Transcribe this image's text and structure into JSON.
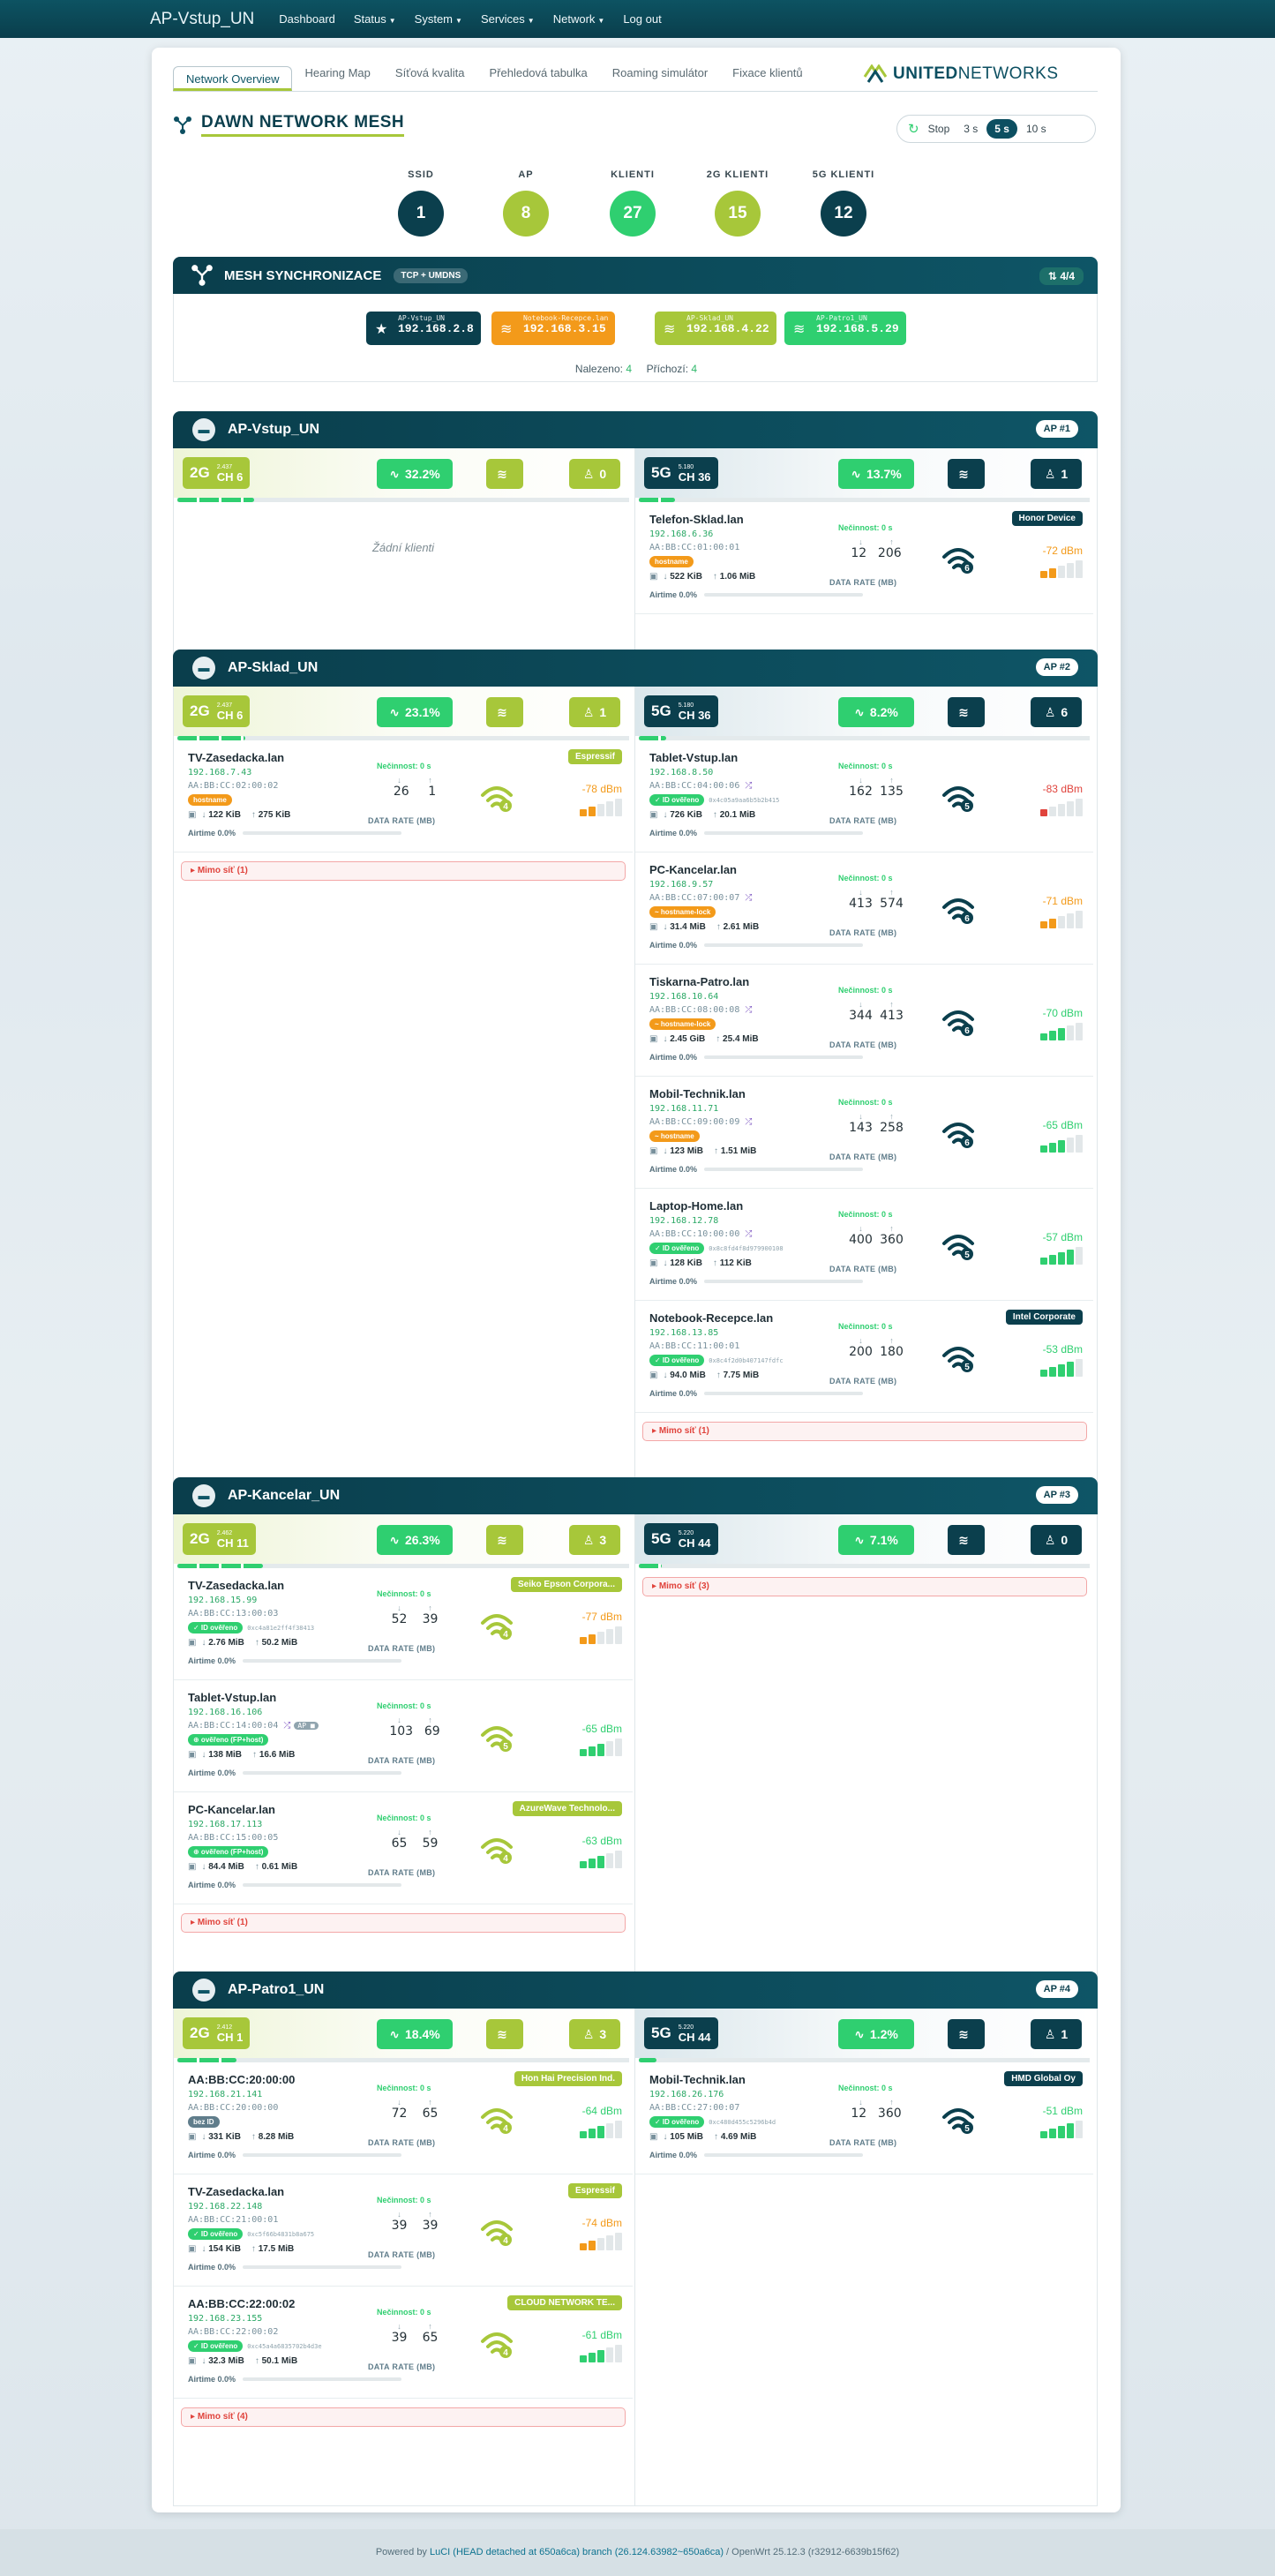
{
  "nav": {
    "brand": "AP-Vstup_UN",
    "items": [
      {
        "label": "Dashboard",
        "caret": false
      },
      {
        "label": "Status",
        "caret": true
      },
      {
        "label": "System",
        "caret": true
      },
      {
        "label": "Services",
        "caret": true
      },
      {
        "label": "Network",
        "caret": true
      },
      {
        "label": "Log out",
        "caret": false
      }
    ]
  },
  "tabs": [
    "Network Overview",
    "Hearing Map",
    "Síťová kvalita",
    "Přehledová tabulka",
    "Roaming simulátor",
    "Fixace klientů"
  ],
  "logo": {
    "a": "UNITED",
    "b": "NETWORKS"
  },
  "title": "DAWN NETWORK MESH",
  "refresh": {
    "stop": "Stop",
    "opts": [
      "3 s",
      "5 s",
      "10 s"
    ],
    "active": "5 s"
  },
  "stats": [
    {
      "label": "SSID",
      "value": "1",
      "color": "#0b3f4d"
    },
    {
      "label": "AP",
      "value": "8",
      "color": "#a7c73a"
    },
    {
      "label": "KLIENTI",
      "value": "27",
      "color": "#2fcf70"
    },
    {
      "label": "2G KLIENTI",
      "value": "15",
      "color": "#a7c73a"
    },
    {
      "label": "5G KLIENTI",
      "value": "12",
      "color": "#0b3f4d"
    }
  ],
  "sync": {
    "title": "MESH SYNCHRONIZACE",
    "tag": "TCP + UMDNS",
    "count": "4/4",
    "found_label": "Nalezeno:",
    "found": "4",
    "arrived_label": "Příchozí:",
    "arrived": "4",
    "chips": [
      {
        "name": "AP-Vstup_UN",
        "ip": "192.168.2.8",
        "color": "#0b3f4d",
        "icon": "★"
      },
      {
        "name": "Notebook-Recepce.lan",
        "ip": "192.168.3.15",
        "color": "#f39a1a",
        "icon": "≋"
      },
      {
        "name": "AP-Sklad_UN",
        "ip": "192.168.4.22",
        "color": "#a7c73a",
        "icon": "≋"
      },
      {
        "name": "AP-Patro1_UN",
        "ip": "192.168.5.29",
        "color": "#2fcf70",
        "icon": "≋"
      }
    ]
  },
  "labels": {
    "idle": "Nečinnost: 0 s",
    "data_rate": "DATA RATE (MB)",
    "airtime": "Airtime 0.0%",
    "no_clients": "Žádní klienti"
  },
  "aps": [
    {
      "name": "AP-Vstup_UN",
      "num": "AP #1",
      "g2": {
        "band": "2G",
        "freq": "2.437",
        "ch": "CH 6",
        "util": "32.2%",
        "clients": "0",
        "prog": 0.17,
        "clients_list": [],
        "mimo": ""
      },
      "g5": {
        "band": "5G",
        "freq": "5.180",
        "ch": "CH 36",
        "util": "13.7%",
        "clients": "1",
        "prog": 0.08,
        "mimo": "",
        "clients_list": [
          {
            "host": "Telefon-Sklad.lan",
            "ip": "192.168.6.36",
            "mac": "AA:BB:CC:01:00:01",
            "pill": "hostname",
            "pillc": "#f39a1a",
            "hash": "",
            "rx": "522 KiB",
            "tx": "1.06 MiB",
            "down": "12",
            "up": "206",
            "wgen": "6",
            "wc": "#0b3f4d",
            "dbm": "-72 dBm",
            "dbmc": "#f39a1a",
            "bars": 2,
            "barc": "#f39a1a",
            "vendor": "Honor Device",
            "vc": "#0b3f4d",
            "shuffle": false
          }
        ]
      }
    },
    {
      "name": "AP-Sklad_UN",
      "num": "AP #2",
      "g2": {
        "band": "2G",
        "freq": "2.437",
        "ch": "CH 6",
        "util": "23.1%",
        "clients": "1",
        "prog": 0.15,
        "mimo": "Mimo síť (1)",
        "clients_list": [
          {
            "host": "TV-Zasedacka.lan",
            "ip": "192.168.7.43",
            "mac": "AA:BB:CC:02:00:02",
            "pill": "hostname",
            "pillc": "#f39a1a",
            "hash": "",
            "rx": "122 KiB",
            "tx": "275 KiB",
            "down": "26",
            "up": "1",
            "wgen": "4",
            "wc": "#a7c73a",
            "dbm": "-78 dBm",
            "dbmc": "#f39a1a",
            "bars": 2,
            "barc": "#f39a1a",
            "vendor": "Espressif",
            "vc": "#a7c73a",
            "shuffle": false
          }
        ]
      },
      "g5": {
        "band": "5G",
        "freq": "5.180",
        "ch": "CH 36",
        "util": "8.2%",
        "clients": "6",
        "prog": 0.06,
        "mimo": "Mimo síť (1)",
        "clients_list": [
          {
            "host": "Tablet-Vstup.lan",
            "ip": "192.168.8.50",
            "mac": "AA:BB:CC:04:00:06",
            "pill": "✓ ID ověřeno",
            "pillc": "#2fcf70",
            "hash": "0x4c05a9aa6b5b2b415",
            "rx": "726 KiB",
            "tx": "20.1 MiB",
            "down": "162",
            "up": "135",
            "wgen": "5",
            "wc": "#0b3f4d",
            "dbm": "-83 dBm",
            "dbmc": "#e0433c",
            "bars": 1,
            "barc": "#e0433c",
            "vendor": "",
            "vc": "",
            "shuffle": true
          },
          {
            "host": "PC-Kancelar.lan",
            "ip": "192.168.9.57",
            "mac": "AA:BB:CC:07:00:07",
            "pill": "~ hostname-lock",
            "pillc": "#f39a1a",
            "hash": "",
            "rx": "31.4 MiB",
            "tx": "2.61 MiB",
            "down": "413",
            "up": "574",
            "wgen": "6",
            "wc": "#0b3f4d",
            "dbm": "-71 dBm",
            "dbmc": "#f39a1a",
            "bars": 2,
            "barc": "#f39a1a",
            "vendor": "",
            "vc": "",
            "shuffle": true
          },
          {
            "host": "Tiskarna-Patro.lan",
            "ip": "192.168.10.64",
            "mac": "AA:BB:CC:08:00:08",
            "pill": "~ hostname-lock",
            "pillc": "#f39a1a",
            "hash": "",
            "rx": "2.45 GiB",
            "tx": "25.4 MiB",
            "down": "344",
            "up": "413",
            "wgen": "6",
            "wc": "#0b3f4d",
            "dbm": "-70 dBm",
            "dbmc": "#2fcf70",
            "bars": 3,
            "barc": "#2fcf70",
            "vendor": "",
            "vc": "",
            "shuffle": true
          },
          {
            "host": "Mobil-Technik.lan",
            "ip": "192.168.11.71",
            "mac": "AA:BB:CC:09:00:09",
            "pill": "~ hostname",
            "pillc": "#f39a1a",
            "hash": "",
            "rx": "123 MiB",
            "tx": "1.51 MiB",
            "down": "143",
            "up": "258",
            "wgen": "6",
            "wc": "#0b3f4d",
            "dbm": "-65 dBm",
            "dbmc": "#2fcf70",
            "bars": 3,
            "barc": "#2fcf70",
            "vendor": "",
            "vc": "",
            "shuffle": true
          },
          {
            "host": "Laptop-Home.lan",
            "ip": "192.168.12.78",
            "mac": "AA:BB:CC:10:00:00",
            "pill": "✓ ID ověřeno",
            "pillc": "#2fcf70",
            "hash": "0x8c8fd4f8d979900108",
            "rx": "128 KiB",
            "tx": "112 KiB",
            "down": "400",
            "up": "360",
            "wgen": "5",
            "wc": "#0b3f4d",
            "dbm": "-57 dBm",
            "dbmc": "#2fcf70",
            "bars": 4,
            "barc": "#2fcf70",
            "vendor": "",
            "vc": "",
            "shuffle": true
          },
          {
            "host": "Notebook-Recepce.lan",
            "ip": "192.168.13.85",
            "mac": "AA:BB:CC:11:00:01",
            "pill": "✓ ID ověřeno",
            "pillc": "#2fcf70",
            "hash": "0x8c4f2d0b407147fdfc",
            "rx": "94.0 MiB",
            "tx": "7.75 MiB",
            "down": "200",
            "up": "180",
            "wgen": "5",
            "wc": "#0b3f4d",
            "dbm": "-53 dBm",
            "dbmc": "#2fcf70",
            "bars": 4,
            "barc": "#2fcf70",
            "vendor": "Intel Corporate",
            "vc": "#0b3f4d",
            "shuffle": false
          }
        ]
      }
    },
    {
      "name": "AP-Kancelar_UN",
      "num": "AP #3",
      "g2": {
        "band": "2G",
        "freq": "2.462",
        "ch": "CH 11",
        "util": "26.3%",
        "clients": "3",
        "prog": 0.19,
        "mimo": "Mimo síť (1)",
        "clients_list": [
          {
            "host": "TV-Zasedacka.lan",
            "ip": "192.168.15.99",
            "mac": "AA:BB:CC:13:00:03",
            "pill": "✓ ID ověřeno",
            "pillc": "#2fcf70",
            "hash": "0xc4a81e2ff4f38413",
            "rx": "2.76 MiB",
            "tx": "50.2 MiB",
            "down": "52",
            "up": "39",
            "wgen": "4",
            "wc": "#a7c73a",
            "dbm": "-77 dBm",
            "dbmc": "#f39a1a",
            "bars": 2,
            "barc": "#f39a1a",
            "vendor": "Seiko Epson Corpora...",
            "vc": "#a7c73a",
            "shuffle": false
          },
          {
            "host": "Tablet-Vstup.lan",
            "ip": "192.168.16.106",
            "mac": "AA:BB:CC:14:00:04",
            "pill": "⊕ ověřeno (FP+host)",
            "pillc": "#2fcf70",
            "hash": "",
            "rx": "138 MiB",
            "tx": "16.6 MiB",
            "down": "103",
            "up": "69",
            "wgen": "5",
            "wc": "#a7c73a",
            "dbm": "-65 dBm",
            "dbmc": "#2fcf70",
            "bars": 3,
            "barc": "#2fcf70",
            "vendor": "",
            "vc": "",
            "shuffle": true,
            "ap_tag": "AP"
          },
          {
            "host": "PC-Kancelar.lan",
            "ip": "192.168.17.113",
            "mac": "AA:BB:CC:15:00:05",
            "pill": "⊕ ověřeno (FP+host)",
            "pillc": "#2fcf70",
            "hash": "",
            "rx": "84.4 MiB",
            "tx": "0.61 MiB",
            "down": "65",
            "up": "59",
            "wgen": "4",
            "wc": "#a7c73a",
            "dbm": "-63 dBm",
            "dbmc": "#2fcf70",
            "bars": 3,
            "barc": "#2fcf70",
            "vendor": "AzureWave Technolo...",
            "vc": "#a7c73a",
            "shuffle": false
          }
        ]
      },
      "g5": {
        "band": "5G",
        "freq": "5.220",
        "ch": "CH 44",
        "util": "7.1%",
        "clients": "0",
        "prog": 0.05,
        "mimo": "Mimo síť (3)",
        "clients_list": []
      }
    },
    {
      "name": "AP-Patro1_UN",
      "num": "AP #4",
      "g2": {
        "band": "2G",
        "freq": "2.412",
        "ch": "CH 1",
        "util": "18.4%",
        "clients": "3",
        "prog": 0.13,
        "mimo": "Mimo síť (4)",
        "clients_list": [
          {
            "host": "AA:BB:CC:20:00:00",
            "ip": "192.168.21.141",
            "mac": "AA:BB:CC:20:00:00",
            "pill": "bez ID",
            "pillc": "#607d8b",
            "hash": "",
            "rx": "331 KiB",
            "tx": "8.28 MiB",
            "down": "72",
            "up": "65",
            "wgen": "4",
            "wc": "#a7c73a",
            "dbm": "-64 dBm",
            "dbmc": "#2fcf70",
            "bars": 3,
            "barc": "#2fcf70",
            "vendor": "Hon Hai Precision Ind.",
            "vc": "#a7c73a",
            "shuffle": false
          },
          {
            "host": "TV-Zasedacka.lan",
            "ip": "192.168.22.148",
            "mac": "AA:BB:CC:21:00:01",
            "pill": "✓ ID ověřeno",
            "pillc": "#2fcf70",
            "hash": "0xc5f66b4831b8a675",
            "rx": "154 KiB",
            "tx": "17.5 MiB",
            "down": "39",
            "up": "39",
            "wgen": "4",
            "wc": "#a7c73a",
            "dbm": "-74 dBm",
            "dbmc": "#f39a1a",
            "bars": 2,
            "barc": "#f39a1a",
            "vendor": "Espressif",
            "vc": "#a7c73a",
            "shuffle": false
          },
          {
            "host": "AA:BB:CC:22:00:02",
            "ip": "192.168.23.155",
            "mac": "AA:BB:CC:22:00:02",
            "pill": "✓ ID ověřeno",
            "pillc": "#2fcf70",
            "hash": "0xc45a4a6835702b4d3e",
            "rx": "32.3 MiB",
            "tx": "50.1 MiB",
            "down": "39",
            "up": "65",
            "wgen": "4",
            "wc": "#a7c73a",
            "dbm": "-61 dBm",
            "dbmc": "#2fcf70",
            "bars": 3,
            "barc": "#2fcf70",
            "vendor": "CLOUD NETWORK TE...",
            "vc": "#a7c73a",
            "shuffle": false
          }
        ]
      },
      "g5": {
        "band": "5G",
        "freq": "5.220",
        "ch": "CH 44",
        "util": "1.2%",
        "clients": "1",
        "prog": 0.04,
        "mimo": "",
        "clients_list": [
          {
            "host": "Mobil-Technik.lan",
            "ip": "192.168.26.176",
            "mac": "AA:BB:CC:27:00:07",
            "pill": "✓ ID ověřeno",
            "pillc": "#2fcf70",
            "hash": "0xc480d455c5296b4d",
            "rx": "105 MiB",
            "tx": "4.69 MiB",
            "down": "12",
            "up": "360",
            "wgen": "5",
            "wc": "#0b3f4d",
            "dbm": "-51 dBm",
            "dbmc": "#2fcf70",
            "bars": 4,
            "barc": "#2fcf70",
            "vendor": "HMD Global Oy",
            "vc": "#0b3f4d",
            "shuffle": false
          }
        ]
      }
    }
  ],
  "footer": {
    "pre": "Powered by ",
    "link": "LuCI (HEAD detached at 650a6ca) branch (26.124.63982~650a6ca)",
    "post": " / OpenWrt 25.12.3 (r32912-6639b15f62)"
  }
}
